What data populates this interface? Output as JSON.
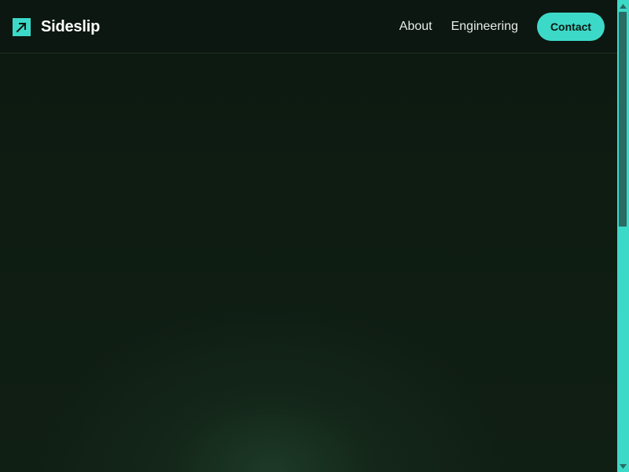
{
  "header": {
    "brand_name": "Sideslip",
    "brand_icon": "arrow-up-right-icon",
    "nav_links": [
      {
        "label": "About"
      },
      {
        "label": "Engineering"
      }
    ],
    "contact_label": "Contact"
  },
  "colors": {
    "accent": "#3dd9c8",
    "background": "#0f1d13",
    "nav_background": "#0b1710",
    "text": "#ffffff",
    "scroll_thumb": "#2a6b63"
  },
  "scrollbar": {
    "icons": [
      "scroll-up-arrow-icon",
      "scroll-down-arrow-icon"
    ]
  }
}
